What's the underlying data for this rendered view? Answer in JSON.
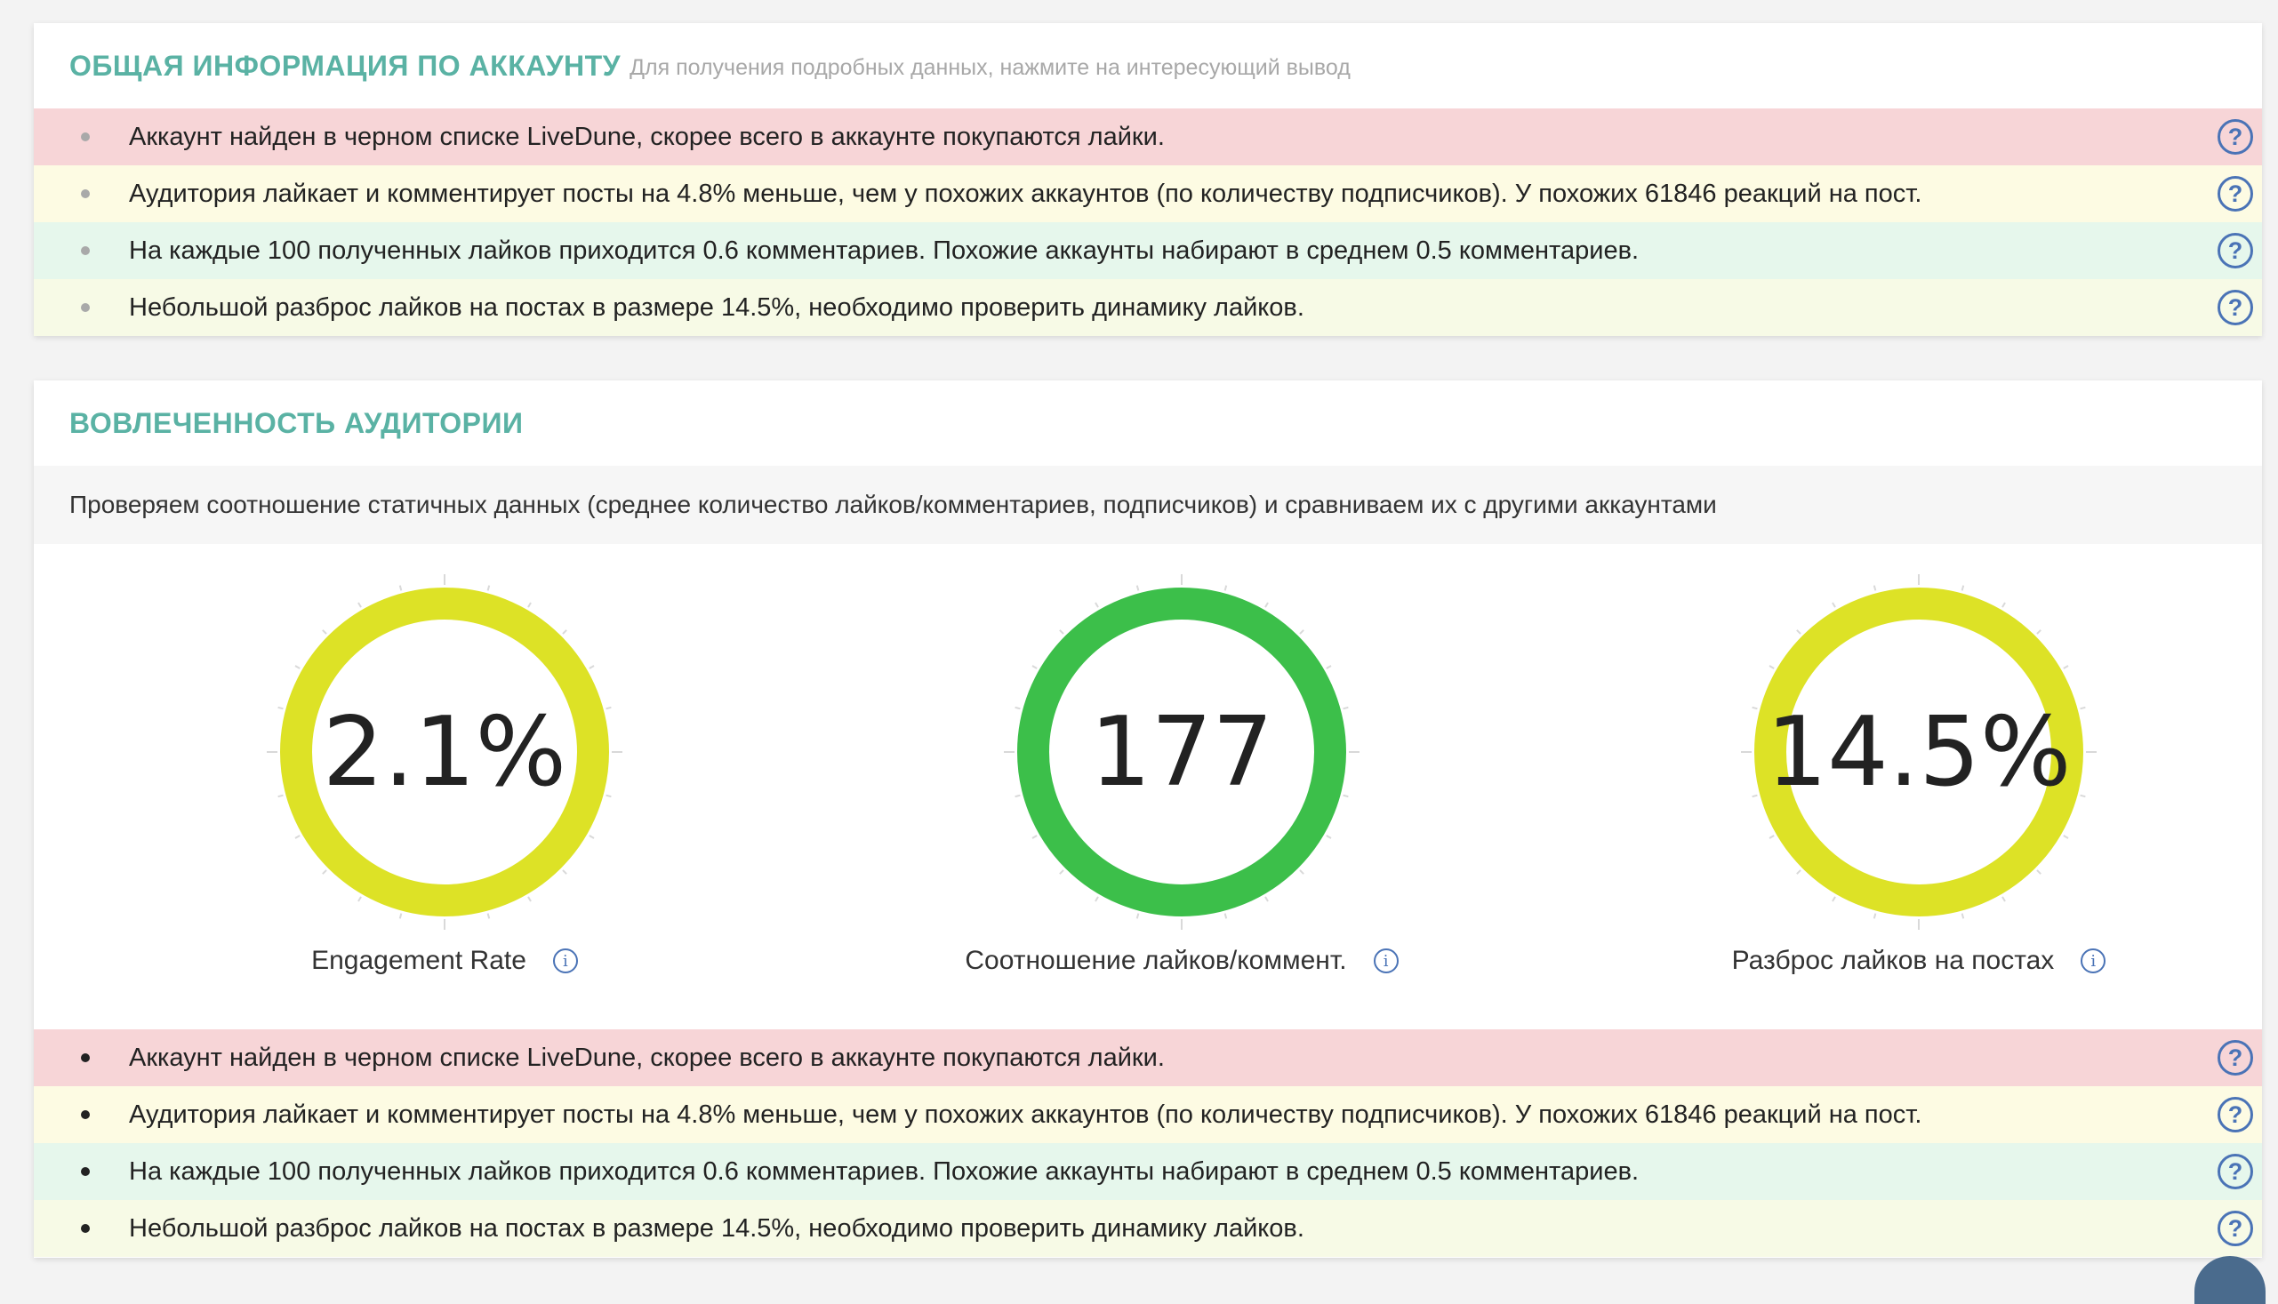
{
  "account": {
    "title": "ОБЩАЯ ИНФОРМАЦИЯ ПО АККАУНТУ",
    "hint": "Для получения подробных данных, нажмите на интересующий вывод",
    "rows": [
      {
        "text": "Аккаунт найден в черном списке LiveDune, скорее всего в аккаунте покупаются лайки.",
        "tone": "red"
      },
      {
        "text": "Аудитория лайкает и комментирует посты на 4.8% меньше, чем у похожих аккаунтов (по количеству подписчиков). У похожих 61846 реакций на пост.",
        "tone": "yellow"
      },
      {
        "text": "На каждые 100 полученных лайков приходится 0.6 комментариев. Похожие аккаунты набирают в среднем 0.5 комментариев.",
        "tone": "green"
      },
      {
        "text": "Небольшой разброс лайков на постах в размере 14.5%, необходимо проверить динамику лайков.",
        "tone": "lime"
      }
    ]
  },
  "engagement": {
    "title": "ВОВЛЕЧЕННОСТЬ АУДИТОРИИ",
    "description": "Проверяем соотношение статичных данных (среднее количество лайков/комментариев, подписчиков) и сравниваем их с другими аккаунтами",
    "gauges": [
      {
        "value": "2.1%",
        "label": "Engagement Rate",
        "color": "#dde226"
      },
      {
        "value": "177",
        "label": "Соотношение лайков/коммент.",
        "color": "#3cbf4a"
      },
      {
        "value": "14.5%",
        "label": "Разброс лайков на постах",
        "color": "#dde226"
      }
    ],
    "rows": [
      {
        "text": "Аккаунт найден в черном списке LiveDune, скорее всего в аккаунте покупаются лайки.",
        "tone": "red"
      },
      {
        "text": "Аудитория лайкает и комментирует посты на 4.8% меньше, чем у похожих аккаунтов (по количеству подписчиков). У похожих 61846 реакций на пост.",
        "tone": "yellow"
      },
      {
        "text": "На каждые 100 полученных лайков приходится 0.6 комментариев. Похожие аккаунты набирают в среднем 0.5 комментариев.",
        "tone": "green"
      },
      {
        "text": "Небольшой разброс лайков на постах в размере 14.5%, необходимо проверить динамику лайков.",
        "tone": "lime"
      }
    ]
  },
  "icons": {
    "help_glyph": "?",
    "info_glyph": "i"
  }
}
